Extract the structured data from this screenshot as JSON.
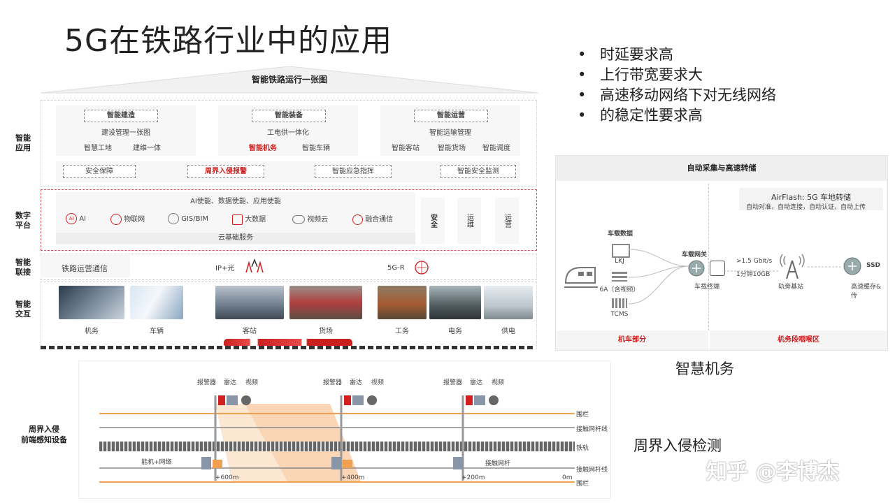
{
  "slide": {
    "title": "5G在铁路行业中的应用",
    "bullets": [
      "时延要求高",
      "上行带宽要求大",
      "高速移动网络下对无线网络",
      "的稳定性要求高"
    ],
    "watermark": "知乎 @李博杰"
  },
  "architecture": {
    "header": "智能铁路运行一张图",
    "side_labels": {
      "app": "智能应用",
      "platform": "数字平台",
      "connect": "智能联接",
      "interact": "智能交互"
    },
    "groups": [
      {
        "name": "智能建造",
        "sub": "建设管理一张图",
        "items": [
          "智慧工地",
          "建维一体"
        ]
      },
      {
        "name": "智能装备",
        "sub": "工电供一体化",
        "items": [
          "智能机务",
          "智能车辆"
        ]
      },
      {
        "name": "智能运营",
        "sub": "智能运输管理",
        "items": [
          "智能客站",
          "智能货场",
          "智能调度"
        ]
      }
    ],
    "app_row": [
      "安全保障",
      "周界入侵报警",
      "智能应急指挥",
      "智能安全监测"
    ],
    "platform": {
      "top": "AI使能、数据使能、应用使能",
      "items": [
        "AI",
        "物联网",
        "GIS/BIM",
        "大数据",
        "视频云",
        "融合通信"
      ],
      "bottom": "云基础服务",
      "side": [
        "安全",
        "运维",
        "运营"
      ]
    },
    "connect": {
      "label": "铁路运营通信",
      "ip": "IP+光",
      "fiveg": "5G-R"
    },
    "interact": [
      "机务",
      "车辆",
      "客站",
      "货场",
      "工务",
      "电务",
      "供电"
    ],
    "colors": {
      "red": "#d21f1f",
      "panel": "#f7f7f7",
      "accent_orange": "#f0a050"
    }
  },
  "depot": {
    "header": "自动采集与高速转储",
    "airflash_title": "AirFlash:  5G 车地转储",
    "airflash_sub": "自动对准，自动连接，自动认证，自动上传",
    "onboard_data": "车载数据",
    "devices": [
      "LKJ",
      "6A（含视频）",
      "TCMS"
    ],
    "gateway": "车载网关",
    "terminal": "车载终端",
    "rate1": ">1.5 Gbit/s",
    "rate2": "1分钟10GB",
    "base_station": "轨旁基站",
    "storage": "高速缓存&传",
    "ssd": "SSD",
    "footer_left": "机车部分",
    "footer_right": "机务段咽喉区",
    "caption": "智慧机务"
  },
  "perimeter": {
    "side_label_1": "周界入侵",
    "side_label_2": "前端感知设备",
    "sensor_labels": [
      "报警器",
      "雷达",
      "视频"
    ],
    "lines": [
      "围栏",
      "接触网杆线",
      "铁轨",
      "接触网杆线",
      "围栏"
    ],
    "equip_left": "能机+网络",
    "equip_right": "接触网杆",
    "distances": [
      "+600m",
      "+400m",
      "+200m",
      "0m"
    ],
    "caption": "周界入侵检测"
  }
}
